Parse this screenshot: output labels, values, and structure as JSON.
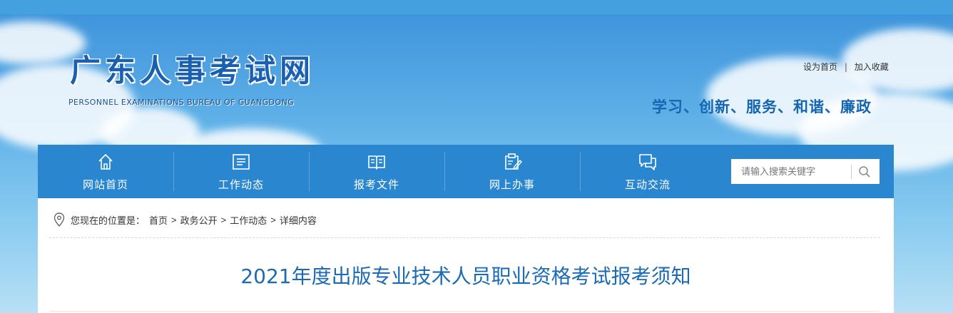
{
  "header": {
    "site_title": "广东人事考试网",
    "site_subtitle": "PERSONNEL EXAMINATIONS BUREAU OF GUANGDONG",
    "top_links": [
      {
        "label": "设为首页"
      },
      {
        "label": "加入收藏"
      }
    ],
    "top_links_separator": "|",
    "slogan": "学习、创新、服务、和谐、廉政"
  },
  "nav": {
    "items": [
      {
        "label": "网站首页",
        "icon": "home-icon"
      },
      {
        "label": "工作动态",
        "icon": "news-list-icon"
      },
      {
        "label": "报考文件",
        "icon": "book-icon"
      },
      {
        "label": "网上办事",
        "icon": "edit-clipboard-icon"
      },
      {
        "label": "互动交流",
        "icon": "chat-bubbles-icon"
      }
    ],
    "search": {
      "placeholder": "请输入搜索关键字",
      "value": "",
      "icon": "search-icon"
    }
  },
  "breadcrumb": {
    "prefix": "您现在的位置是：",
    "separator": ">",
    "items": [
      {
        "label": "首页"
      },
      {
        "label": "政务公开"
      },
      {
        "label": "工作动态"
      },
      {
        "label": "详细内容"
      }
    ],
    "icon": "location-pin-icon"
  },
  "article": {
    "title": "2021年度出版专业技术人员职业资格考试报考须知"
  },
  "colors": {
    "nav_bg": "#2a86cf",
    "title": "#1a6ab4",
    "slogan": "#1466b2"
  }
}
